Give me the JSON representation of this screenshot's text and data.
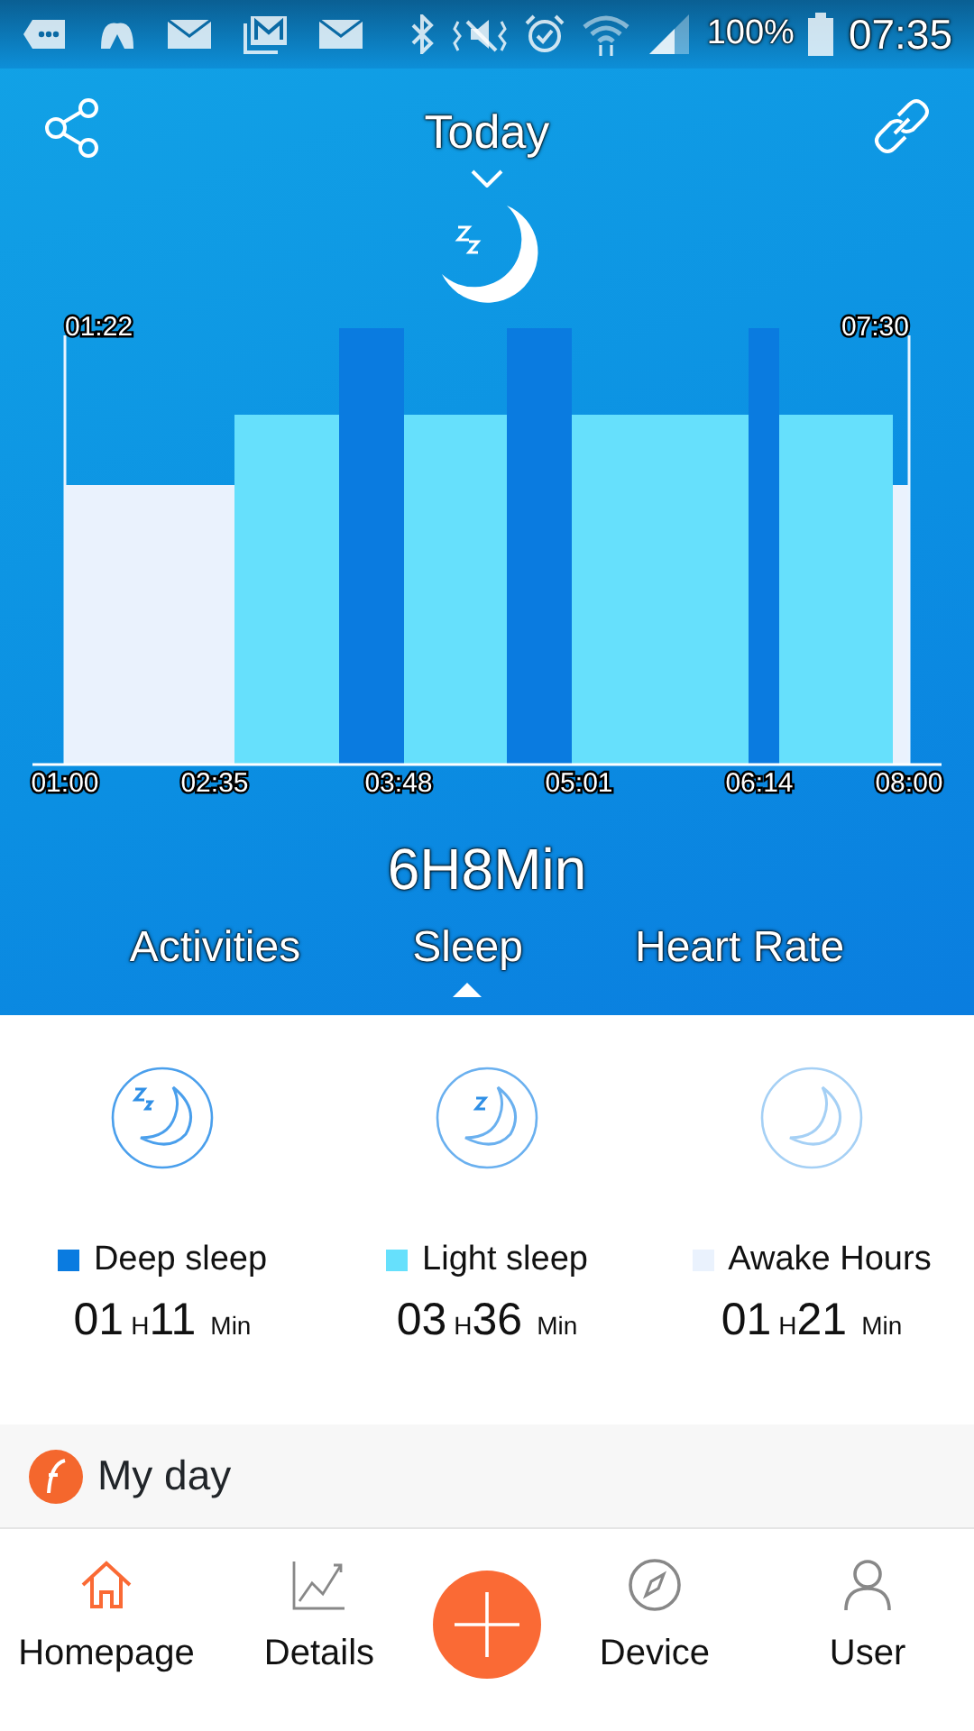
{
  "status_bar": {
    "battery": "100%",
    "time": "07:35"
  },
  "header": {
    "title": "Today"
  },
  "chart": {
    "start_label": "01:22",
    "end_label": "07:30",
    "x_labels": [
      "01:00",
      "02:35",
      "03:48",
      "05:01",
      "06:14",
      "08:00"
    ]
  },
  "total": "6H8Min",
  "tabs": [
    {
      "label": "Activities",
      "selected": false
    },
    {
      "label": "Sleep",
      "selected": true
    },
    {
      "label": "Heart Rate",
      "selected": false
    }
  ],
  "stats": [
    {
      "kind": "deep",
      "name": "Deep sleep",
      "color": "#0a7be0",
      "hours": "01",
      "h_unit": "H",
      "minutes": "11",
      "m_unit": "Min"
    },
    {
      "kind": "light",
      "name": "Light sleep",
      "color": "#66e0fc",
      "hours": "03",
      "h_unit": "H",
      "minutes": "36",
      "m_unit": "Min"
    },
    {
      "kind": "awake",
      "name": "Awake Hours",
      "color": "#eaf2fd",
      "hours": "01",
      "h_unit": "H",
      "minutes": "21",
      "m_unit": "Min"
    }
  ],
  "my_day": {
    "title": "My day"
  },
  "nav": [
    {
      "kind": "home",
      "label": "Homepage",
      "selected": true
    },
    {
      "kind": "chart",
      "label": "Details",
      "selected": false
    },
    {
      "kind": "add"
    },
    {
      "kind": "compass",
      "label": "Device",
      "selected": false
    },
    {
      "kind": "user",
      "label": "User",
      "selected": false
    }
  ]
}
